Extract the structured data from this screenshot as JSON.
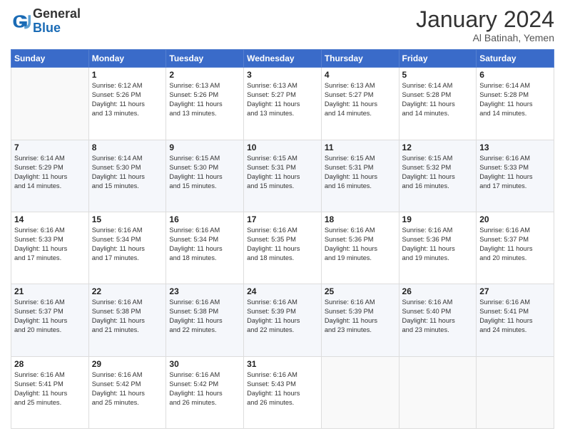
{
  "logo": {
    "text_general": "General",
    "text_blue": "Blue"
  },
  "header": {
    "month_year": "January 2024",
    "location": "Al Batinah, Yemen"
  },
  "weekdays": [
    "Sunday",
    "Monday",
    "Tuesday",
    "Wednesday",
    "Thursday",
    "Friday",
    "Saturday"
  ],
  "weeks": [
    [
      {
        "day": "",
        "sunrise": "",
        "sunset": "",
        "daylight": ""
      },
      {
        "day": "1",
        "sunrise": "Sunrise: 6:12 AM",
        "sunset": "Sunset: 5:26 PM",
        "daylight": "Daylight: 11 hours and 13 minutes."
      },
      {
        "day": "2",
        "sunrise": "Sunrise: 6:13 AM",
        "sunset": "Sunset: 5:26 PM",
        "daylight": "Daylight: 11 hours and 13 minutes."
      },
      {
        "day": "3",
        "sunrise": "Sunrise: 6:13 AM",
        "sunset": "Sunset: 5:27 PM",
        "daylight": "Daylight: 11 hours and 13 minutes."
      },
      {
        "day": "4",
        "sunrise": "Sunrise: 6:13 AM",
        "sunset": "Sunset: 5:27 PM",
        "daylight": "Daylight: 11 hours and 14 minutes."
      },
      {
        "day": "5",
        "sunrise": "Sunrise: 6:14 AM",
        "sunset": "Sunset: 5:28 PM",
        "daylight": "Daylight: 11 hours and 14 minutes."
      },
      {
        "day": "6",
        "sunrise": "Sunrise: 6:14 AM",
        "sunset": "Sunset: 5:28 PM",
        "daylight": "Daylight: 11 hours and 14 minutes."
      }
    ],
    [
      {
        "day": "7",
        "sunrise": "Sunrise: 6:14 AM",
        "sunset": "Sunset: 5:29 PM",
        "daylight": "Daylight: 11 hours and 14 minutes."
      },
      {
        "day": "8",
        "sunrise": "Sunrise: 6:14 AM",
        "sunset": "Sunset: 5:30 PM",
        "daylight": "Daylight: 11 hours and 15 minutes."
      },
      {
        "day": "9",
        "sunrise": "Sunrise: 6:15 AM",
        "sunset": "Sunset: 5:30 PM",
        "daylight": "Daylight: 11 hours and 15 minutes."
      },
      {
        "day": "10",
        "sunrise": "Sunrise: 6:15 AM",
        "sunset": "Sunset: 5:31 PM",
        "daylight": "Daylight: 11 hours and 15 minutes."
      },
      {
        "day": "11",
        "sunrise": "Sunrise: 6:15 AM",
        "sunset": "Sunset: 5:31 PM",
        "daylight": "Daylight: 11 hours and 16 minutes."
      },
      {
        "day": "12",
        "sunrise": "Sunrise: 6:15 AM",
        "sunset": "Sunset: 5:32 PM",
        "daylight": "Daylight: 11 hours and 16 minutes."
      },
      {
        "day": "13",
        "sunrise": "Sunrise: 6:16 AM",
        "sunset": "Sunset: 5:33 PM",
        "daylight": "Daylight: 11 hours and 17 minutes."
      }
    ],
    [
      {
        "day": "14",
        "sunrise": "Sunrise: 6:16 AM",
        "sunset": "Sunset: 5:33 PM",
        "daylight": "Daylight: 11 hours and 17 minutes."
      },
      {
        "day": "15",
        "sunrise": "Sunrise: 6:16 AM",
        "sunset": "Sunset: 5:34 PM",
        "daylight": "Daylight: 11 hours and 17 minutes."
      },
      {
        "day": "16",
        "sunrise": "Sunrise: 6:16 AM",
        "sunset": "Sunset: 5:34 PM",
        "daylight": "Daylight: 11 hours and 18 minutes."
      },
      {
        "day": "17",
        "sunrise": "Sunrise: 6:16 AM",
        "sunset": "Sunset: 5:35 PM",
        "daylight": "Daylight: 11 hours and 18 minutes."
      },
      {
        "day": "18",
        "sunrise": "Sunrise: 6:16 AM",
        "sunset": "Sunset: 5:36 PM",
        "daylight": "Daylight: 11 hours and 19 minutes."
      },
      {
        "day": "19",
        "sunrise": "Sunrise: 6:16 AM",
        "sunset": "Sunset: 5:36 PM",
        "daylight": "Daylight: 11 hours and 19 minutes."
      },
      {
        "day": "20",
        "sunrise": "Sunrise: 6:16 AM",
        "sunset": "Sunset: 5:37 PM",
        "daylight": "Daylight: 11 hours and 20 minutes."
      }
    ],
    [
      {
        "day": "21",
        "sunrise": "Sunrise: 6:16 AM",
        "sunset": "Sunset: 5:37 PM",
        "daylight": "Daylight: 11 hours and 20 minutes."
      },
      {
        "day": "22",
        "sunrise": "Sunrise: 6:16 AM",
        "sunset": "Sunset: 5:38 PM",
        "daylight": "Daylight: 11 hours and 21 minutes."
      },
      {
        "day": "23",
        "sunrise": "Sunrise: 6:16 AM",
        "sunset": "Sunset: 5:38 PM",
        "daylight": "Daylight: 11 hours and 22 minutes."
      },
      {
        "day": "24",
        "sunrise": "Sunrise: 6:16 AM",
        "sunset": "Sunset: 5:39 PM",
        "daylight": "Daylight: 11 hours and 22 minutes."
      },
      {
        "day": "25",
        "sunrise": "Sunrise: 6:16 AM",
        "sunset": "Sunset: 5:39 PM",
        "daylight": "Daylight: 11 hours and 23 minutes."
      },
      {
        "day": "26",
        "sunrise": "Sunrise: 6:16 AM",
        "sunset": "Sunset: 5:40 PM",
        "daylight": "Daylight: 11 hours and 23 minutes."
      },
      {
        "day": "27",
        "sunrise": "Sunrise: 6:16 AM",
        "sunset": "Sunset: 5:41 PM",
        "daylight": "Daylight: 11 hours and 24 minutes."
      }
    ],
    [
      {
        "day": "28",
        "sunrise": "Sunrise: 6:16 AM",
        "sunset": "Sunset: 5:41 PM",
        "daylight": "Daylight: 11 hours and 25 minutes."
      },
      {
        "day": "29",
        "sunrise": "Sunrise: 6:16 AM",
        "sunset": "Sunset: 5:42 PM",
        "daylight": "Daylight: 11 hours and 25 minutes."
      },
      {
        "day": "30",
        "sunrise": "Sunrise: 6:16 AM",
        "sunset": "Sunset: 5:42 PM",
        "daylight": "Daylight: 11 hours and 26 minutes."
      },
      {
        "day": "31",
        "sunrise": "Sunrise: 6:16 AM",
        "sunset": "Sunset: 5:43 PM",
        "daylight": "Daylight: 11 hours and 26 minutes."
      },
      {
        "day": "",
        "sunrise": "",
        "sunset": "",
        "daylight": ""
      },
      {
        "day": "",
        "sunrise": "",
        "sunset": "",
        "daylight": ""
      },
      {
        "day": "",
        "sunrise": "",
        "sunset": "",
        "daylight": ""
      }
    ]
  ]
}
